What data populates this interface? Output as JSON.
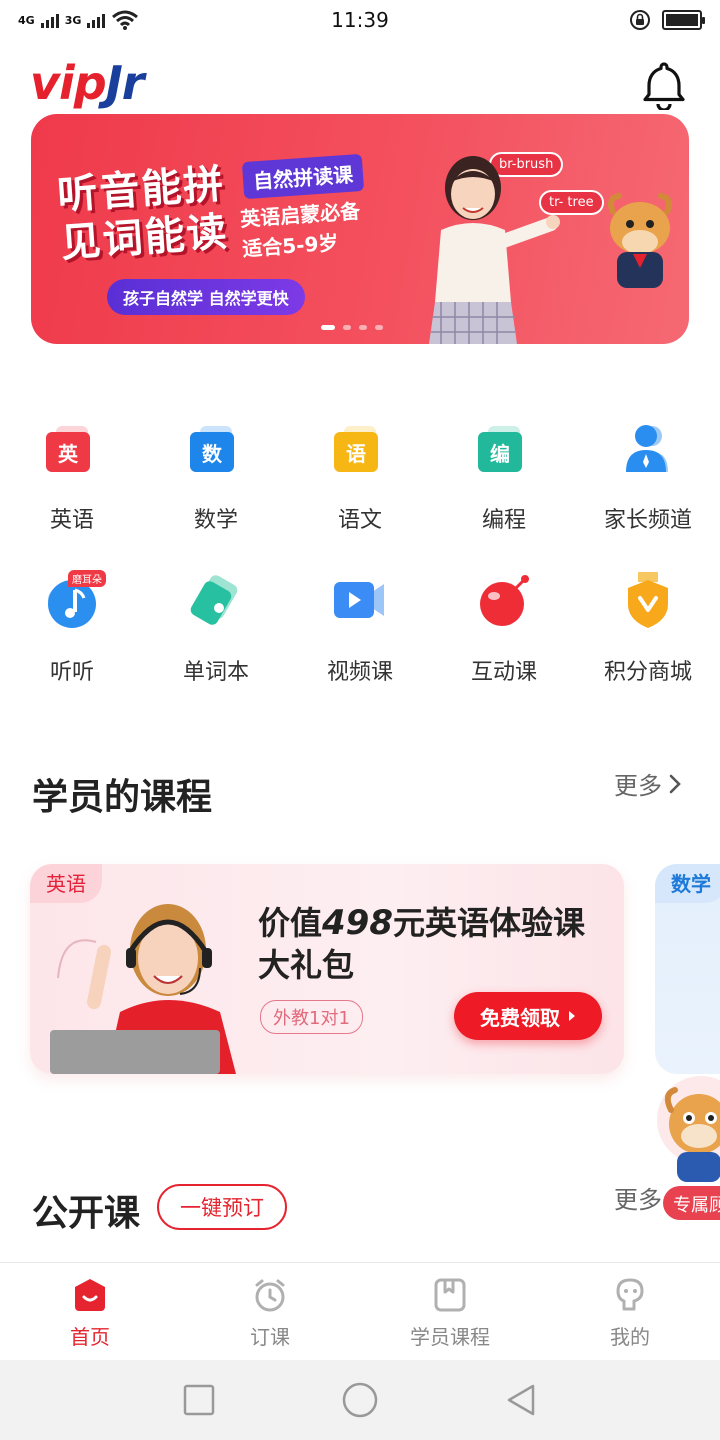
{
  "status_bar": {
    "network_1": "4G",
    "network_2": "3G",
    "time": "11:39"
  },
  "header": {
    "logo_part1": "vip",
    "logo_part2": "Jr",
    "bell_icon": "bell-icon"
  },
  "banner": {
    "title_line1": "听音能拼",
    "title_line2": "见词能读",
    "tag": "自然拼读课",
    "sub_line1": "英语启蒙必备",
    "sub_line2": "适合5-9岁",
    "pill": "孩子自然学 自然学更快",
    "bubble1": "br-brush",
    "bubble2": "tr- tree",
    "current_slide": 1,
    "slide_count": 4,
    "colors": {
      "bg": "#ef3a4b",
      "accent": "#5f37d6"
    }
  },
  "grid": {
    "row1": [
      {
        "label": "英语",
        "glyph": "英",
        "color": "#ef3a46",
        "icon": "english-icon"
      },
      {
        "label": "数学",
        "glyph": "数",
        "color": "#1e86ea",
        "icon": "math-icon"
      },
      {
        "label": "语文",
        "glyph": "语",
        "color": "#f6b613",
        "icon": "chinese-icon"
      },
      {
        "label": "编程",
        "glyph": "编",
        "color": "#22b89b",
        "icon": "programming-icon"
      },
      {
        "label": "家长频道",
        "color": "#2a8ef0",
        "icon": "parent-channel-icon"
      }
    ],
    "row2": [
      {
        "label": "听听",
        "badge": "磨耳朵",
        "color": "#2b8ff0",
        "icon": "music-note-icon"
      },
      {
        "label": "单词本",
        "color": "#27c0a0",
        "icon": "wordbook-icon"
      },
      {
        "label": "视频课",
        "color": "#3b8cf5",
        "icon": "video-icon"
      },
      {
        "label": "互动课",
        "color": "#ef2d36",
        "icon": "interactive-ball-icon"
      },
      {
        "label": "积分商城",
        "color": "#f7a81b",
        "icon": "points-shield-icon"
      }
    ]
  },
  "courses_section": {
    "title": "学员的课程",
    "more": "更多"
  },
  "course_card": {
    "tag": "英语",
    "title_prefix": "价值",
    "title_price": "498",
    "title_suffix": "元英语体验课",
    "title_line2": "大礼包",
    "chip": "外教1对1",
    "button": "免费领取"
  },
  "course_card_2": {
    "tag": "数学"
  },
  "floating": {
    "label": "专属顾问"
  },
  "public_section": {
    "title": "公开课",
    "book_button": "一键预订",
    "more": "更多"
  },
  "tabbar": {
    "active": 0,
    "colors": {
      "active": "#e5242f",
      "inactive": "#888888"
    },
    "tabs": [
      {
        "label": "首页",
        "icon": "home-icon"
      },
      {
        "label": "订课",
        "icon": "alarm-clock-icon"
      },
      {
        "label": "学员课程",
        "icon": "course-book-icon"
      },
      {
        "label": "我的",
        "icon": "profile-icon"
      }
    ]
  }
}
